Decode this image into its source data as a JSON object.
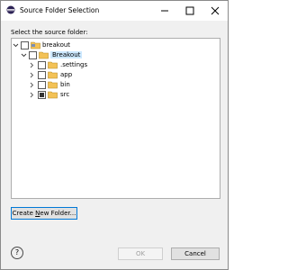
{
  "window": {
    "title": "Source Folder Selection"
  },
  "prompt": {
    "text": "Select the source folder:"
  },
  "tree": {
    "items": [
      {
        "label": "breakout",
        "expanded": true,
        "checked": "unchecked",
        "icon": "project-folder-icon",
        "selected": false
      },
      {
        "label": "Breakout",
        "expanded": true,
        "checked": "unchecked",
        "icon": "folder-icon",
        "selected": true
      },
      {
        "label": ".settings",
        "expanded": false,
        "checked": "unchecked",
        "icon": "folder-icon",
        "selected": false
      },
      {
        "label": "app",
        "expanded": false,
        "checked": "unchecked",
        "icon": "folder-icon",
        "selected": false
      },
      {
        "label": "bin",
        "expanded": false,
        "checked": "unchecked",
        "icon": "folder-icon",
        "selected": false
      },
      {
        "label": "src",
        "expanded": false,
        "checked": "partial",
        "icon": "folder-icon",
        "selected": false
      }
    ]
  },
  "buttons": {
    "create_new_folder": {
      "pre": "Create ",
      "mnemonic": "N",
      "post": "ew Folder..."
    },
    "ok": "OK",
    "cancel": "Cancel"
  },
  "help": {
    "symbol": "?"
  },
  "colors": {
    "selection": "#cce8ff",
    "folder": "#f3c256",
    "accent": "#0078d7"
  }
}
